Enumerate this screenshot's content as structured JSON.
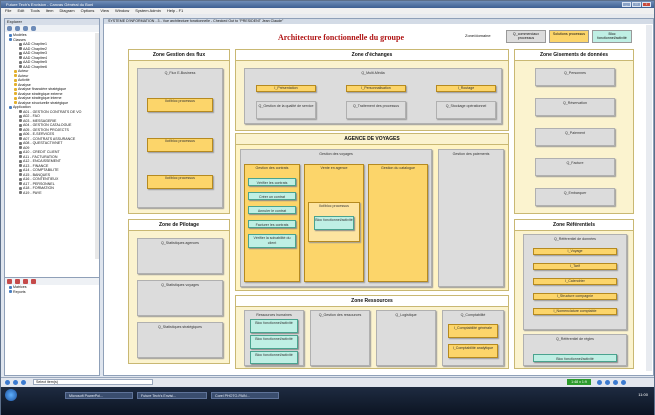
{
  "window": {
    "title": "Future Tech's Envision - Canvas Général du Bonl"
  },
  "menu": [
    "File",
    "Edit",
    "Tools",
    "Item",
    "Diagram",
    "Options",
    "View",
    "Window",
    "System Admin",
    "Help - F1"
  ],
  "left_panel": {
    "header": "Explorer",
    "tree": [
      {
        "label": "Modèles",
        "kind": "f"
      },
      {
        "label": "Classes",
        "kind": "f"
      },
      {
        "label": "AAD Chapitre1",
        "kind": "g"
      },
      {
        "label": "AAD Chapitre2",
        "kind": "g"
      },
      {
        "label": "AAD Chapitre3",
        "kind": "g"
      },
      {
        "label": "AAD Chapitre4",
        "kind": "g"
      },
      {
        "label": "AAD Chapitre5",
        "kind": "g"
      },
      {
        "label": "AAD Chapitre6",
        "kind": "g"
      },
      {
        "label": "Acteur",
        "kind": "y"
      },
      {
        "label": "Acteur",
        "kind": "y"
      },
      {
        "label": "Activité",
        "kind": "y"
      },
      {
        "label": "Analyse",
        "kind": "y"
      },
      {
        "label": "Analyse financière stratégique",
        "kind": "y"
      },
      {
        "label": "Analyse stratégique externe",
        "kind": "y"
      },
      {
        "label": "Analyse stratégique interne",
        "kind": "y"
      },
      {
        "label": "Analyse structurelle stratégique",
        "kind": "y"
      },
      {
        "label": "Application",
        "kind": "f"
      },
      {
        "label": "A01 - GESTION CONTRATS DE VO",
        "kind": "g"
      },
      {
        "label": "A02 - FAO",
        "kind": "g"
      },
      {
        "label": "A03 - MESSAGERIE",
        "kind": "g"
      },
      {
        "label": "A04 - GESTION CATALOGUE",
        "kind": "g"
      },
      {
        "label": "A05 - GESTION PROJECTS",
        "kind": "g"
      },
      {
        "label": "A06 - E-SERVICES",
        "kind": "g"
      },
      {
        "label": "A07 - CONTRATS ASSURANCE",
        "kind": "g"
      },
      {
        "label": "A08 - QUESTACTIVNET",
        "kind": "g"
      },
      {
        "label": "A09",
        "kind": "g"
      },
      {
        "label": "A10 - CREDIT CLIENT",
        "kind": "g"
      },
      {
        "label": "A11 - FACTURATION",
        "kind": "g"
      },
      {
        "label": "A12 - ENCAISSEMENT",
        "kind": "g"
      },
      {
        "label": "A13 - FINANCE",
        "kind": "g"
      },
      {
        "label": "A14 - COMPTABILITE",
        "kind": "g"
      },
      {
        "label": "A15 - BANQUES",
        "kind": "g"
      },
      {
        "label": "A16 - CONTENTIEUX",
        "kind": "g"
      },
      {
        "label": "A17 - PERSONNEL",
        "kind": "g"
      },
      {
        "label": "A18 - FORMATION",
        "kind": "g"
      },
      {
        "label": "A19 - PAYE",
        "kind": "g"
      }
    ],
    "lower_items": [
      "Matrices",
      "Reports"
    ]
  },
  "tab": {
    "label": "SYSTEME D'INFORMATION - 3 - Vue architecture fonctionnelle - Checked Out to \"PRESIDENT Jean Claude\""
  },
  "diagram": {
    "title": "Architecture fonctionnelle du groupe",
    "domain_label": "Zone/domaine",
    "legend": [
      "Q_commerciaux processus",
      "Solutions processus",
      "Bloc fonctionnel/activité"
    ],
    "zones": {
      "flux": {
        "title": "Zone Gestion des flux",
        "box": "Q_Flux E-Business",
        "items": [
          "Ilot/bloc processus",
          "Ilot/bloc processus",
          "Ilot/bloc processus"
        ]
      },
      "echanges": {
        "title": "Zone d'échanges",
        "top": "Q_Multi-Média",
        "row1": [
          "I_Présentation",
          "I_Personnalisation",
          "I_Routage"
        ],
        "row2": [
          "Q_Gestion de la qualité de service",
          "Q_Traitement des processus",
          "Q_Stockage opérationnel"
        ]
      },
      "gisements": {
        "title": "Zone Gisements de données",
        "items": [
          "Q_Personnes",
          "Q_Réservation",
          "Q_Paiement",
          "Q_Facture",
          "Q_Embarquer"
        ]
      },
      "agence": {
        "title": "AGENCE DE VOYAGES",
        "voyages": "Gestion des voyages",
        "paiements": "Gestion des paiements",
        "contrats": "Gestion des contrats",
        "vente": "Vente en agence",
        "catalogue": "Gestion du catalogue",
        "contract_items": [
          "Vérifier les contrats",
          "Créer un contrat",
          "Annuler le contrat",
          "Facturer les contrats",
          "Vérifier la solvabilité du client"
        ],
        "vente_items": [
          "Ilot/bloc processus",
          "Bloc fonctionnel/activité"
        ]
      },
      "pilotage": {
        "title": "Zone de Pilotage",
        "items": [
          "Q_Statistiques agences",
          "Q_Statistiques voyages",
          "Q_Statistiques stratégiques"
        ]
      },
      "ressources": {
        "title": "Zone Ressources",
        "rh": "Ressources humaines",
        "bloc": "Bloc fonctionnel/activité",
        "items": [
          "Q_Gestion des ressources",
          "Q_Logistique",
          "Q_Comptabilité"
        ],
        "compta_items": [
          "I_Comptabilité générale",
          "I_Comptabilité analytique"
        ]
      },
      "referentiels": {
        "title": "Zone Référentiels",
        "box1": "Q_Référentiel de données",
        "items": [
          "I_Voyage",
          "I_Tarif",
          "I_Calendrier",
          "I_Structure compagnie",
          "I_Nomenclature comptable"
        ],
        "box2": "Q_Référentiel de règles",
        "bloc": "Bloc fonctionnel/activité"
      }
    }
  },
  "status": {
    "text": "Select item(s)",
    "zoom": "1:48 x 1:9"
  },
  "taskbar": [
    "Microsoft PowerPoi...",
    "Future Tech's Envisi...",
    "Corel PHOTO-PAIN..."
  ],
  "clock": "11:00"
}
